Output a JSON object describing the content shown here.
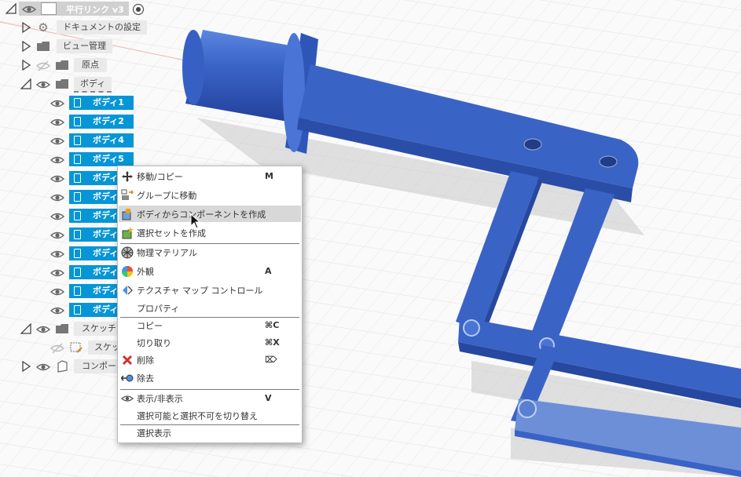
{
  "browser": {
    "root": {
      "label": "平行リンク v3"
    },
    "items": [
      {
        "label": "ドキュメントの設定",
        "icon": "gear-icon"
      },
      {
        "label": "ビュー管理",
        "icon": "folder-icon"
      },
      {
        "label": "原点",
        "icon": "folder-icon"
      },
      {
        "label": "ボディ",
        "icon": "folder-icon"
      }
    ],
    "bodies": [
      "ボディ1",
      "ボディ2",
      "ボディ4",
      "ボディ5",
      "ボディ",
      "ボディ",
      "ボディ",
      "ボディ",
      "ボディ",
      "ボディ",
      "ボディ",
      "ボディ"
    ],
    "sketch_folder": "スケッチ",
    "sketch_item": "スケッ",
    "component": "コンポー"
  },
  "context_menu": {
    "items": [
      {
        "label": "移動/コピー",
        "shortcut": "M",
        "icon": "move-icon"
      },
      {
        "label": "グループに移動",
        "shortcut": "",
        "icon": "group-move-icon"
      },
      {
        "label": "ボディからコンポーネントを作成",
        "shortcut": "",
        "icon": "create-component-icon"
      },
      {
        "label": "選択セットを作成",
        "shortcut": "",
        "icon": "selection-set-icon"
      },
      {
        "label": "物理マテリアル",
        "shortcut": "",
        "icon": "material-icon"
      },
      {
        "label": "外観",
        "shortcut": "A",
        "icon": "appearance-icon"
      },
      {
        "label": "テクスチャ マップ コントロール",
        "shortcut": "",
        "icon": "texture-map-icon"
      },
      {
        "label": "プロパティ",
        "shortcut": "",
        "icon": ""
      },
      {
        "label": "コピー",
        "shortcut": "⌘C",
        "icon": ""
      },
      {
        "label": "切り取り",
        "shortcut": "⌘X",
        "icon": ""
      },
      {
        "label": "削除",
        "shortcut": "⌦",
        "icon": "delete-icon"
      },
      {
        "label": "除去",
        "shortcut": "",
        "icon": "remove-icon"
      },
      {
        "label": "表示/非表示",
        "shortcut": "V",
        "icon": "eye-icon"
      },
      {
        "label": "選択可能と選択不可を切り替え",
        "shortcut": "",
        "icon": ""
      },
      {
        "label": "選択表示",
        "shortcut": "",
        "icon": ""
      }
    ],
    "highlighted": "ボディからコンポーネントを作成"
  },
  "colors": {
    "selection": "#0696d7",
    "model_blue": "#3b64c4",
    "menu_bg": "#ffffff"
  }
}
